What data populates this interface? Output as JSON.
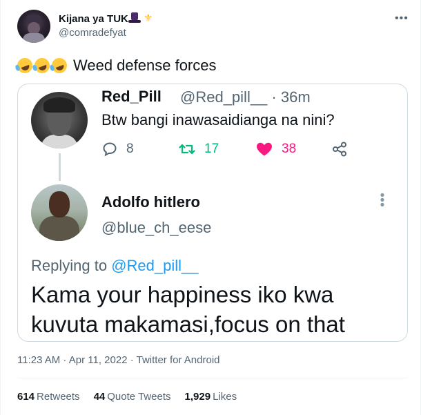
{
  "tweet": {
    "author_name": "Kijana ya TUK",
    "author_handle": "@comradefyat",
    "more_icon": "more-horizontal-icon",
    "text": "Weed defense forces",
    "emoji_names": [
      "rofl-emoji",
      "rofl-emoji",
      "rofl-emoji"
    ],
    "meta": "11:23 AM · Apr 11, 2022 · Twitter for Android",
    "stats": {
      "retweets_count": "614",
      "retweets_label": "Retweets",
      "quotes_count": "44",
      "quotes_label": "Quote Tweets",
      "likes_count": "1,929",
      "likes_label": "Likes"
    }
  },
  "quoted": {
    "first": {
      "name": "Red_Pill",
      "handle_time": "@Red_pill__ · 36m",
      "text": "Btw bangi inawasaidianga na nini?",
      "reply_count": "8",
      "retweet_count": "17",
      "like_count": "38"
    },
    "second": {
      "name": "Adolfo hitlero",
      "handle": "@blue_ch_eese",
      "replying_prefix": "Replying to ",
      "replying_to": "@Red_pill__",
      "body": "Kama your happiness iko kwa kuvuta makamasi,focus on that"
    }
  },
  "colors": {
    "text": "#0f1419",
    "secondary": "#536471",
    "link": "#1d9bf0",
    "retweet": "#00ba7c",
    "like": "#f91880",
    "border": "#cfd9de"
  }
}
